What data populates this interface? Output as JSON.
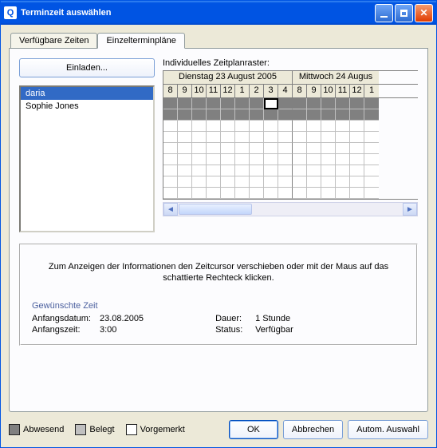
{
  "title": "Terminzeit auswählen",
  "tabs": [
    "Verfügbare Zeiten",
    "Einzelterminpläne"
  ],
  "active_tab": 1,
  "invite_label": "Einladen...",
  "attendees": [
    "daria",
    "Sophie Jones"
  ],
  "selected_attendee": 0,
  "grid": {
    "label": "Individuelles Zeitplanraster:",
    "days": [
      {
        "name": "Dienstag 23 August 2005",
        "hours": [
          "8",
          "9",
          "10",
          "11",
          "12",
          "1",
          "2",
          "3",
          "4"
        ]
      },
      {
        "name": "Mittwoch 24 Augus",
        "hours": [
          "8",
          "9",
          "10",
          "11",
          "12",
          "1"
        ]
      }
    ],
    "marker_col": 7,
    "day1_cols": 9,
    "rows": 9
  },
  "hint": "Zum Anzeigen der Informationen den Zeitcursor verschieben oder mit der\nMaus auf das schattierte Rechteck klicken.",
  "section_title": "Gewünschte Zeit",
  "details": {
    "start_date_k": "Anfangsdatum:",
    "start_date_v": "23.08.2005",
    "start_time_k": "Anfangszeit:",
    "start_time_v": "3:00",
    "duration_k": "Dauer:",
    "duration_v": "1 Stunde",
    "status_k": "Status:",
    "status_v": "Verfügbar"
  },
  "legend": {
    "absent": "Abwesend",
    "busy": "Belegt",
    "tent": "Vorgemerkt"
  },
  "buttons": {
    "ok": "OK",
    "cancel": "Abbrechen",
    "auto": "Autom. Auswahl"
  }
}
